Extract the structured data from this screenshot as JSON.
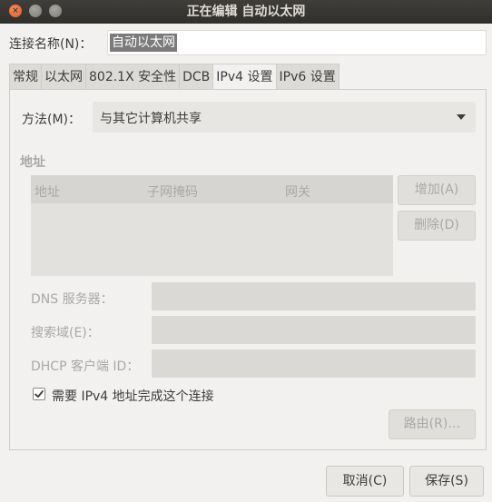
{
  "window": {
    "title": "正在编辑 自动以太网",
    "close_glyph": "×"
  },
  "connection": {
    "label": "连接名称(N)：",
    "value": "自动以太网"
  },
  "tabs": [
    {
      "label": "常规",
      "active": false
    },
    {
      "label": "以太网",
      "active": false
    },
    {
      "label": "802.1X 安全性",
      "active": false
    },
    {
      "label": "DCB",
      "active": false
    },
    {
      "label": "IPv4 设置",
      "active": true
    },
    {
      "label": "IPv6 设置",
      "active": false
    }
  ],
  "method": {
    "label": "方法(M)：",
    "value": "与其它计算机共享"
  },
  "addresses": {
    "title": "地址",
    "columns": [
      "地址",
      "子网掩码",
      "网关"
    ],
    "rows": [],
    "add_label": "增加(A)",
    "delete_label": "删除(D)"
  },
  "fields": {
    "dns_label": "DNS 服务器：",
    "dns_value": "",
    "search_label": "搜索域(E)：",
    "search_value": "",
    "dhcp_label": "DHCP 客户端 ID：",
    "dhcp_value": ""
  },
  "require_ipv4": {
    "label": "需要 IPv4 地址完成这个连接",
    "checked": true
  },
  "routes_label": "路由(R)…",
  "footer": {
    "cancel_label": "取消(C)",
    "save_label": "保存(S)"
  },
  "colors": {
    "titlebar_bg": "#3a3935",
    "close_button": "#e65c24",
    "disabled_text": "#a9a8a4",
    "selection": "#7b7b7b"
  }
}
